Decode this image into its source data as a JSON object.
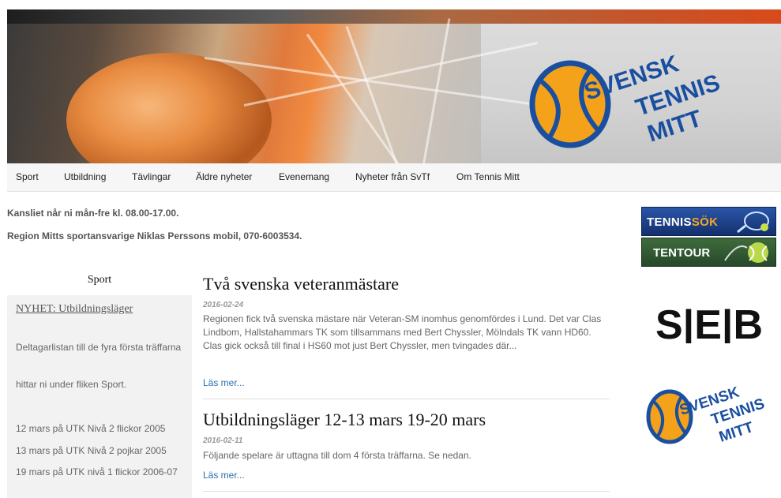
{
  "banner": {
    "logo_lines": [
      "SVENSK",
      "TENNIS",
      "MITT"
    ]
  },
  "nav": {
    "items": [
      {
        "label": "Sport"
      },
      {
        "label": "Utbildning"
      },
      {
        "label": "Tävlingar"
      },
      {
        "label": "Äldre nyheter"
      },
      {
        "label": "Evenemang"
      },
      {
        "label": "Nyheter från SvTf"
      },
      {
        "label": "Om Tennis Mitt"
      }
    ]
  },
  "info": {
    "line1": "Kansliet når ni mån-fre kl. 08.00-17.00.",
    "line2": "Region Mitts sportansvarige Niklas Perssons mobil, 070-6003534."
  },
  "sidebar": {
    "title": "Sport",
    "link": "NYHET: Utbildningsläger",
    "texts": [
      "Deltagarlistan till de fyra första träffarna",
      "hittar ni under fliken Sport.",
      "12 mars på UTK Nivå 2 flickor 2005",
      "13 mars på UTK Nivå 2 pojkar 2005",
      "19 mars på UTK nivå 1 flickor 2006-07"
    ]
  },
  "articles": [
    {
      "title": "Två svenska veteranmästare",
      "date": "2016-02-24",
      "body": "Regionen fick två svenska mästare när Veteran-SM inomhus genomfördes i Lund. Det var Clas Lindbom, Hallstahammars TK som tillsammans med Bert Chyssler, Mölndals TK vann HD60. Clas gick också till final i HS60 mot just Bert Chyssler, men tvingades där...",
      "read_more": "Läs mer..."
    },
    {
      "title": "Utbildningsläger 12-13 mars 19-20 mars",
      "date": "2016-02-11",
      "body": "Följande spelare är uttagna till dom 4 första träffarna. Se nedan.",
      "read_more": "Läs mer..."
    }
  ],
  "right": {
    "tennissok_a": "TENNIS",
    "tennissok_b": "SÖK",
    "tentour": "TENTOUR",
    "seb": "S|E|B",
    "logo_lines": [
      "SVENSK",
      "TENNIS",
      "MITT"
    ]
  },
  "colors": {
    "link": "#2a6fb0",
    "logo_blue": "#1a4fa0",
    "logo_orange": "#f5a21b",
    "nav_bg": "#f6f6f6"
  }
}
